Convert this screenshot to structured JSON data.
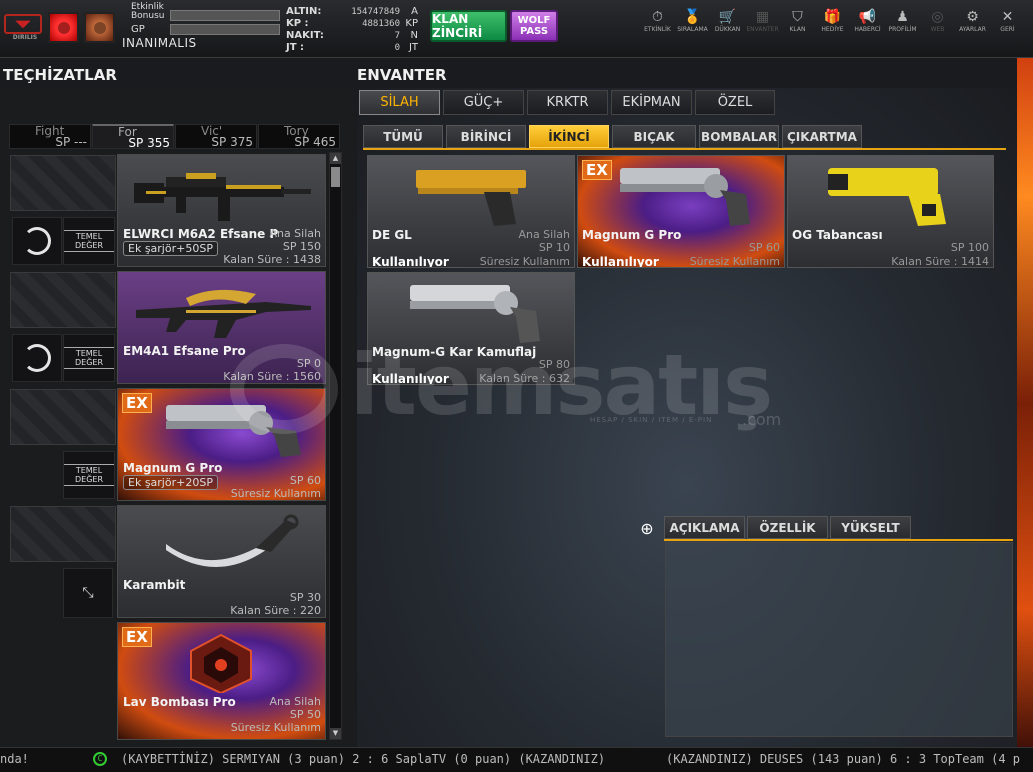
{
  "topbar": {
    "logo_text": "DIRILIS",
    "bonus_label": "Etkinlik Bonusu",
    "gp_label": "GP",
    "username": "INANIMALIS",
    "currencies": [
      {
        "label": "ALTIN:",
        "value": "154747849",
        "unit": "A"
      },
      {
        "label": "KP :",
        "value": "4881360",
        "unit": "KP"
      },
      {
        "label": "NAKIT:",
        "value": "7",
        "unit": "N"
      },
      {
        "label": "JT :",
        "value": "0",
        "unit": "JT"
      }
    ],
    "clan_button": "KLAN ZİNCİRİ",
    "wolf_pass": "WOLF PASS",
    "nav": [
      {
        "label": "ETKİNLİK",
        "icon": "stopwatch-icon",
        "glyph": "⏱",
        "dim": false
      },
      {
        "label": "SIRALAMA",
        "icon": "medal-icon",
        "glyph": "🏅",
        "dim": false
      },
      {
        "label": "DÜKKAN",
        "icon": "cart-icon",
        "glyph": "🛒",
        "dim": false
      },
      {
        "label": "ENVANTER",
        "icon": "inventory-icon",
        "glyph": "▦",
        "dim": true
      },
      {
        "label": "KLAN",
        "icon": "shield-icon",
        "glyph": "⛉",
        "dim": false
      },
      {
        "label": "HEDİYE",
        "icon": "gift-icon",
        "glyph": "🎁",
        "dim": false
      },
      {
        "label": "HABERCİ",
        "icon": "megaphone-icon",
        "glyph": "📢",
        "dim": false
      },
      {
        "label": "PROFİLİM",
        "icon": "profile-icon",
        "glyph": "♟",
        "dim": false
      },
      {
        "label": "WEB",
        "icon": "globe-icon",
        "glyph": "◎",
        "dim": true
      },
      {
        "label": "AYARLAR",
        "icon": "gear-icon",
        "glyph": "⚙",
        "dim": false
      },
      {
        "label": "GERİ",
        "icon": "close-icon",
        "glyph": "✕",
        "dim": false
      }
    ]
  },
  "left": {
    "title": "TEÇHİZATLAR",
    "class_tabs": [
      {
        "name": "Fight",
        "sp": "SP ---"
      },
      {
        "name": "For",
        "sp": "SP 355"
      },
      {
        "name": "Vic'",
        "sp": "SP 375"
      },
      {
        "name": "Tory",
        "sp": "SP 465"
      }
    ],
    "temel_label": "TEMEL DEĞER",
    "slots": [
      {
        "name": "ELWRCI M6A2 Efsane P",
        "type": "Ana Silah",
        "sp": "SP 150",
        "tag": "Ek şarjör+50SP",
        "duration": "Kalan Süre : 1438",
        "ex": false
      },
      {
        "name": "EM4A1 Efsane Pro",
        "type": "",
        "sp": "SP 0",
        "tag": "",
        "duration": "Kalan Süre : 1560",
        "ex": false
      },
      {
        "name": "Magnum G Pro",
        "type": "",
        "sp": "SP 60",
        "tag": "Ek şarjör+20SP",
        "duration": "Süresiz Kullanım",
        "ex": true
      },
      {
        "name": "Karambit",
        "type": "",
        "sp": "SP 30",
        "tag": "",
        "duration": "Kalan Süre : 220",
        "ex": false
      },
      {
        "name": "Lav Bombası Pro",
        "type": "Ana Silah",
        "sp": "SP 50",
        "tag": "",
        "duration": "Süresiz Kullanım",
        "ex": true
      }
    ]
  },
  "right": {
    "title": "ENVANTER",
    "main_tabs": [
      "SİLAH",
      "GÜÇ+",
      "KRKTR",
      "EKİPMAN",
      "ÖZEL"
    ],
    "sub_tabs": [
      "TÜMÜ",
      "BİRİNCİ",
      "İKİNCİ",
      "BIÇAK",
      "BOMBALAR",
      "ÇIKARTMA"
    ],
    "items": [
      {
        "name": "DE GL",
        "type": "Ana Silah",
        "sp": "SP 10",
        "status": "Kullanılıyor",
        "duration": "Süresiz Kullanım",
        "ex": false
      },
      {
        "name": "Magnum G Pro",
        "type": "",
        "sp": "SP 60",
        "status": "Kullanılıyor",
        "duration": "Süresiz Kullanım",
        "ex": true
      },
      {
        "name": "OG Tabancası",
        "type": "",
        "sp": "SP 100",
        "status": "",
        "duration": "Kalan Süre : 1414",
        "ex": false
      },
      {
        "name": "Magnum-G Kar Kamuflaj",
        "type": "",
        "sp": "SP 80",
        "status": "Kullanılıyor",
        "duration": "Kalan Süre : 632",
        "ex": false
      }
    ],
    "detail_tabs": [
      "AÇIKLAMA",
      "ÖZELLİK",
      "YÜKSELT"
    ]
  },
  "watermark": {
    "brand": "itemsatış",
    "tld": ".com",
    "tagline": "HESAP / SKIN / ITEM / E-PIN"
  },
  "ticker": {
    "left": "nda!",
    "middle": "(KAYBETTİNİZ) SERMIYAN (3 puan) 2 : 6 SaplaTV (0 puan) (KAZANDINIZ)",
    "right": "(KAZANDINIZ) DEUSES (143 puan) 6 : 3 TopTeam (4 p"
  },
  "badge": "EX"
}
